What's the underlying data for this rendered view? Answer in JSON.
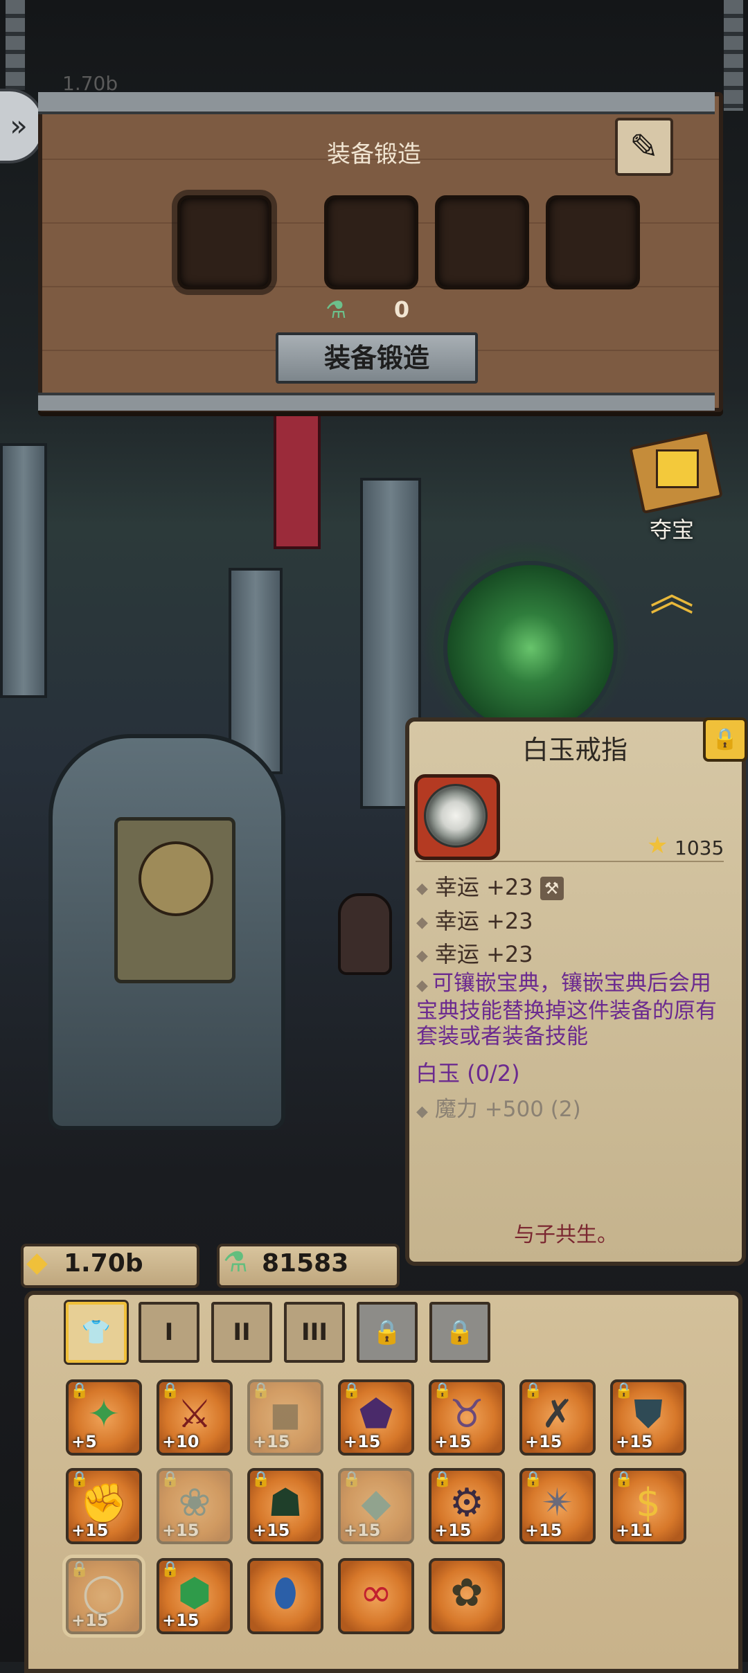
{
  "forge": {
    "title": "装备锻造",
    "potion_count": "0",
    "button_label": "装备锻造"
  },
  "top_left_hint": "1.70b",
  "treasure": {
    "label": "夺宝"
  },
  "item_card": {
    "name": "白玉戒指",
    "score": "1035",
    "stats": [
      "幸运 +23",
      "幸运 +23",
      "幸运 +23"
    ],
    "description": "可镶嵌宝典，镶嵌宝典后会用宝典技能替换掉这件装备的原有套装或者装备技能",
    "set_name": "白玉 (0/2)",
    "set_bonus": "魔力 +500 (2)",
    "flavor": "与子共生。"
  },
  "currency": {
    "gold": "1.70b",
    "potion": "81583"
  },
  "tabs": [
    {
      "label": "",
      "icon": "shirt-icon",
      "state": "active"
    },
    {
      "label": "I",
      "state": "normal"
    },
    {
      "label": "II",
      "state": "normal"
    },
    {
      "label": "III",
      "state": "normal"
    },
    {
      "label": "",
      "icon": "lock-icon",
      "state": "locked"
    },
    {
      "label": "",
      "icon": "lock-icon",
      "state": "locked"
    }
  ],
  "inventory": {
    "row1": [
      "+5",
      "+10",
      "+15",
      "+15",
      "+15",
      "+15",
      "+15"
    ],
    "row2": [
      "+15",
      "+15",
      "+15",
      "+15",
      "+15",
      "+15",
      "+11"
    ],
    "row3": [
      "+15",
      "+15"
    ]
  },
  "colors": {
    "accent_gold": "#f0c03a",
    "parchment": "#d6c7a5",
    "purple_text": "#6b2a8f"
  }
}
